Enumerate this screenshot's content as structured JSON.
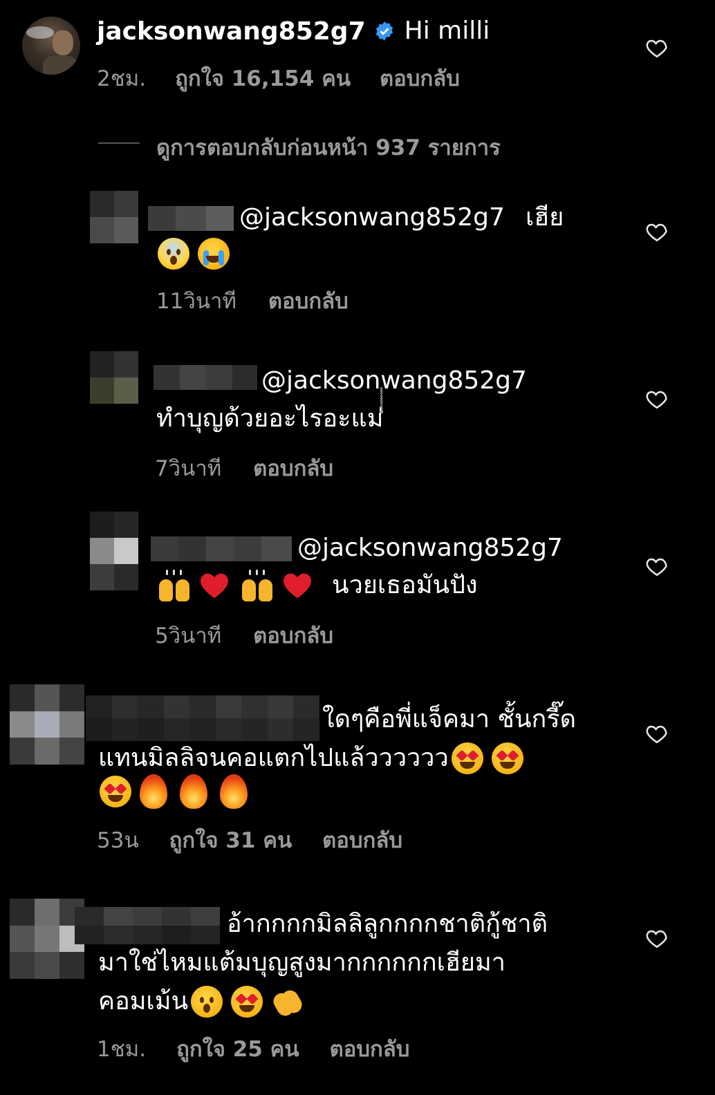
{
  "top_comment": {
    "username": "jacksonwang852g7",
    "verified": true,
    "text": "Hi milli",
    "time": "2ชม.",
    "likes": "ถูกใจ 16,154 คน",
    "reply": "ตอบกลับ"
  },
  "view_previous": "ดูการตอบกลับก่อนหน้า 937 รายการ",
  "replies": [
    {
      "mention": "@jacksonwang852g7",
      "text": "เฮีย",
      "time": "11วินาที",
      "reply": "ตอบกลับ"
    },
    {
      "mention": "@jacksonwang852g7",
      "text": "ทำบุญด้วยอะไรอะแม่",
      "trailing": "ํํํํํํํํํํ",
      "time": "7วินาที",
      "reply": "ตอบกลับ"
    },
    {
      "mention": "@jacksonwang852g7",
      "text": "นวยเธอมันปัง",
      "time": "5วินาที",
      "reply": "ตอบกลับ"
    }
  ],
  "comments": [
    {
      "line1": "ใดๆคือพี่แจ็คมา ชั้นกรี๊ด",
      "line2": "แทนมิลลิจนคอแตกไปแล้วววววว",
      "time": "53น",
      "likes": "ถูกใจ 31 คน",
      "reply": "ตอบกลับ"
    },
    {
      "line1": "อ้ากกกกมิลลิลูกกกกชาติกู้ชาติ",
      "line2": "มาใช่ไหมแต้มบุญสูงมากกกกกกเฮียมา",
      "line3": "คอมเม้น",
      "time": "1ชม.",
      "likes": "ถูกใจ 25 คน",
      "reply": "ตอบกลับ"
    }
  ],
  "icons": {
    "heart": "heart-outline-icon",
    "verified": "verified-badge-icon"
  },
  "colors": {
    "background": "#000000",
    "text": "#ffffff",
    "meta": "#9a9a9a",
    "verified": "#3897f0"
  }
}
